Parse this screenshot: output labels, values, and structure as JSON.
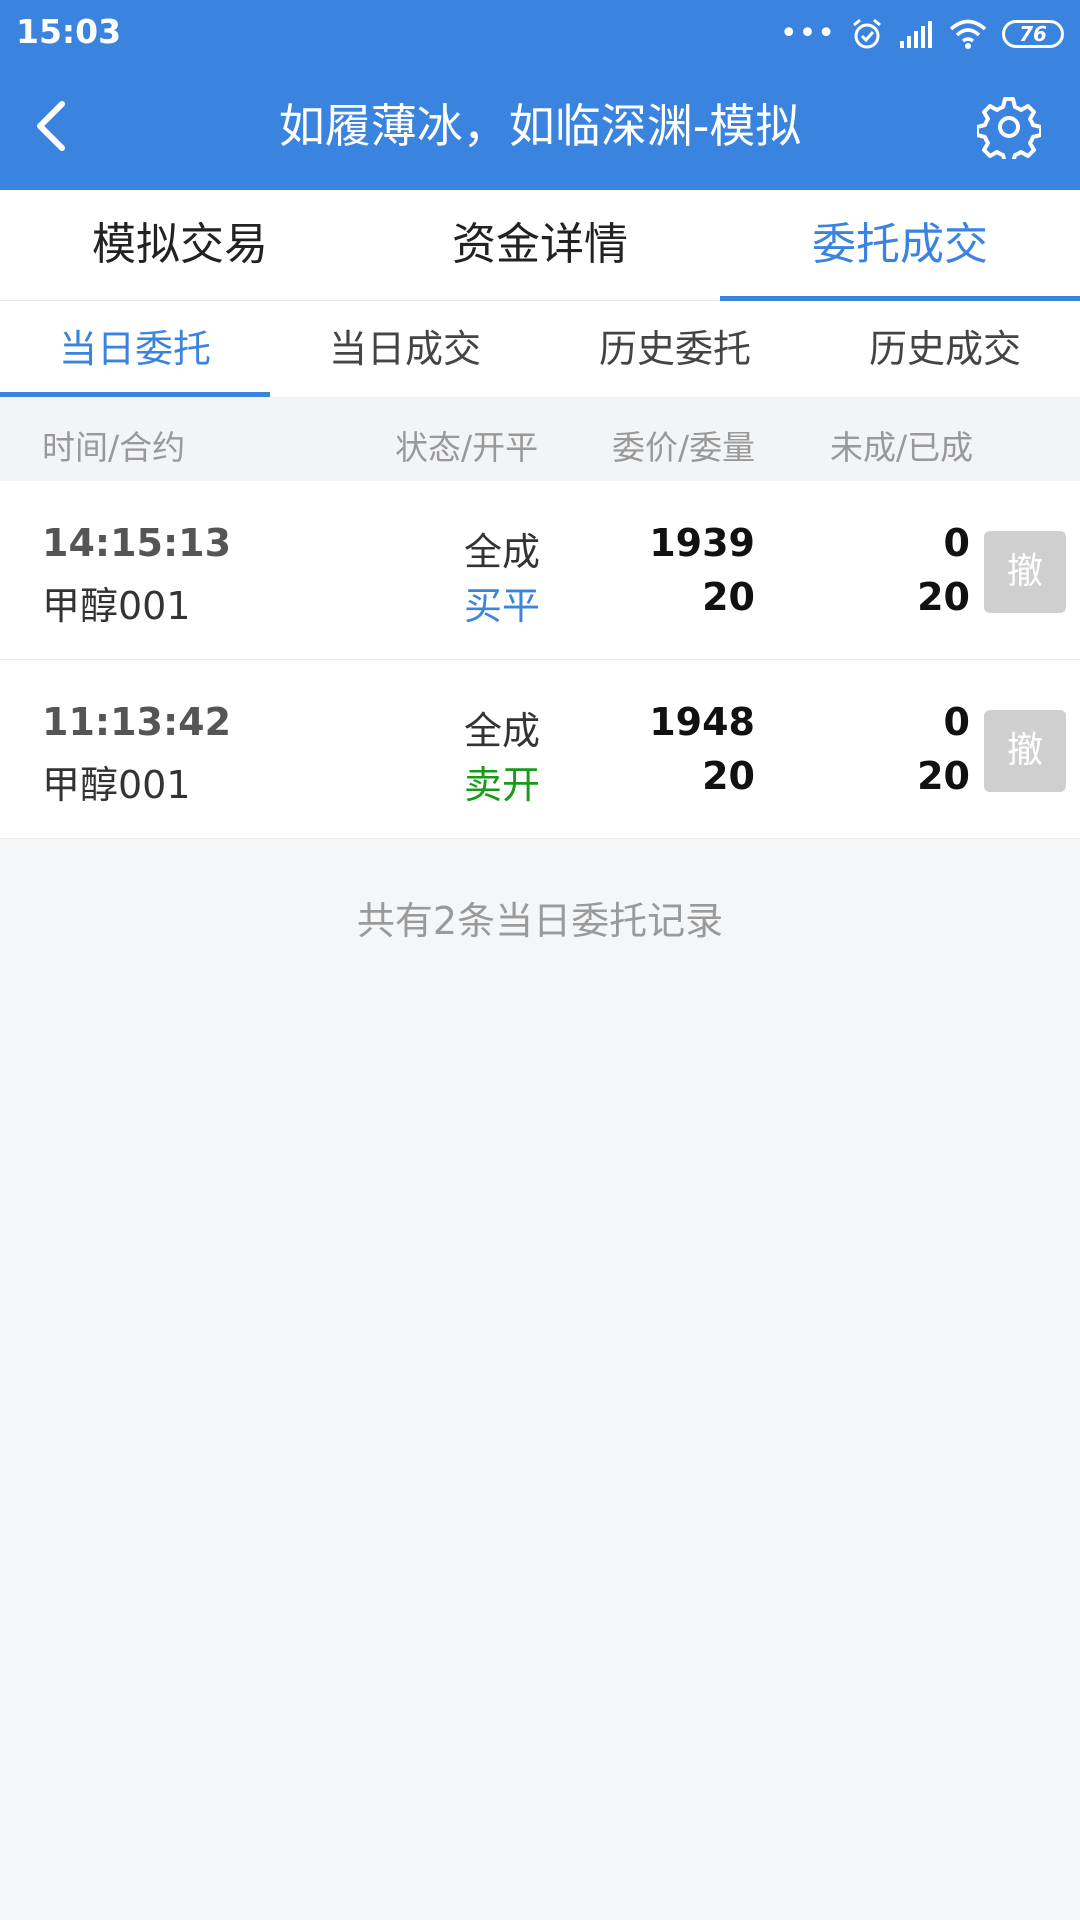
{
  "status_bar": {
    "time": "15:03",
    "battery": "76",
    "icons": [
      "more-dots-icon",
      "alarm-icon",
      "signal-icon",
      "wifi-icon",
      "battery-icon"
    ]
  },
  "nav": {
    "title": "如履薄冰，如临深渊-模拟",
    "back_icon": "chevron-left-icon",
    "settings_icon": "gear-icon"
  },
  "main_tabs": [
    {
      "label": "模拟交易",
      "active": false
    },
    {
      "label": "资金详情",
      "active": false
    },
    {
      "label": "委托成交",
      "active": true
    }
  ],
  "sub_tabs": [
    {
      "label": "当日委托",
      "active": true
    },
    {
      "label": "当日成交",
      "active": false
    },
    {
      "label": "历史委托",
      "active": false
    },
    {
      "label": "历史成交",
      "active": false
    }
  ],
  "columns": {
    "time_contract": "时间/合约",
    "status_openclose": "状态/开平",
    "price_qty": "委价/委量",
    "unfilled_filled": "未成/已成"
  },
  "orders": [
    {
      "time": "14:15:13",
      "contract": "甲醇001",
      "status": "全成",
      "open_close": "买平",
      "price": "1939",
      "quantity": "20",
      "unfilled": "0",
      "filled": "20",
      "cancel_label": "撤"
    },
    {
      "time": "11:13:42",
      "contract": "甲醇001",
      "status": "全成",
      "open_close": "卖开",
      "price": "1948",
      "quantity": "20",
      "unfilled": "0",
      "filled": "20",
      "cancel_label": "撤"
    }
  ],
  "summary": "共有2条当日委托记录",
  "colors": {
    "brand": "#3a84e0",
    "buy": "#3a84e0",
    "sell": "#1a9a1a"
  }
}
